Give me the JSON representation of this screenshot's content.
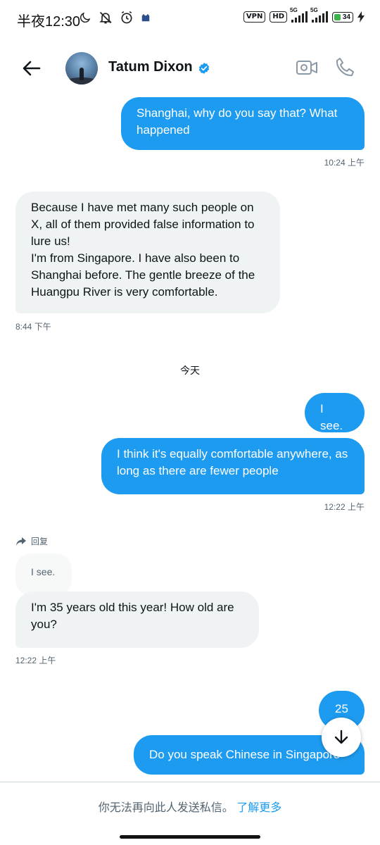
{
  "status_bar": {
    "time": "半夜12:30",
    "vpn_label": "VPN",
    "hd_label": "HD",
    "net1": "5G",
    "net2": "5G",
    "battery": "34"
  },
  "header": {
    "contact_name": "Tatum Dixon",
    "verified_color": "#1d9bf0"
  },
  "colors": {
    "accent": "#1d9bf0",
    "incoming_bg": "#eff3f4"
  },
  "messages": [
    {
      "id": "m1",
      "direction": "out",
      "text": "Shanghai, why do you say that? What happened",
      "time": "10:24 上午"
    },
    {
      "id": "m2",
      "direction": "in",
      "text": "Because I have met many such people on X, all of them provided false information to lure us!\nI'm from Singapore. I have also been to Shanghai before. The gentle breeze of the Huangpu River is very comfortable.",
      "time": "8:44 下午"
    },
    {
      "id": "m3",
      "direction": "out",
      "text": "I see."
    },
    {
      "id": "m4",
      "direction": "out",
      "text": "I think it's equally comfortable anywhere, as long as there are fewer people",
      "time": "12:22 上午"
    },
    {
      "id": "m5",
      "direction": "in",
      "reply_label": "回复",
      "quoted_text": "I see.",
      "text": "I'm 35 years old this year! How old are you?",
      "time": "12:22 上午"
    },
    {
      "id": "m6",
      "direction": "out",
      "text": "25"
    },
    {
      "id": "m7",
      "direction": "out",
      "text": "Do you speak Chinese in Singapore"
    }
  ],
  "day_separator": "今天",
  "footer": {
    "notice": "你无法再向此人发送私信。",
    "link": "了解更多"
  }
}
